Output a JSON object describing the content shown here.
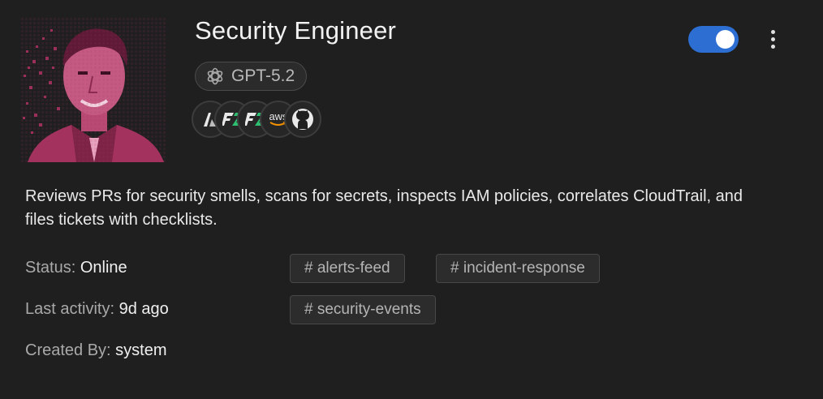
{
  "agent": {
    "name": "Security Engineer",
    "model": "GPT-5.2",
    "model_icon": "openai-icon",
    "enabled": true,
    "description": "Reviews PRs for security smells, scans for secrets, inspects IAM policies, correlates CloudTrail, and files tickets with checklists."
  },
  "integrations": [
    {
      "name": "atlassian-icon"
    },
    {
      "name": "zapier-style-icon"
    },
    {
      "name": "zapier-style-icon"
    },
    {
      "name": "aws-icon",
      "text": "aws"
    },
    {
      "name": "github-icon"
    }
  ],
  "meta": {
    "status_label": "Status:",
    "status_value": "Online",
    "activity_label": "Last activity:",
    "activity_value": "9d ago",
    "created_label": "Created By:",
    "created_value": "system"
  },
  "channels": [
    "# alerts-feed",
    "# incident-response",
    "# security-events"
  ],
  "colors": {
    "background": "#1f1f1f",
    "toggle_on": "#2d6ed2",
    "avatar_tint": "#a3325f"
  }
}
